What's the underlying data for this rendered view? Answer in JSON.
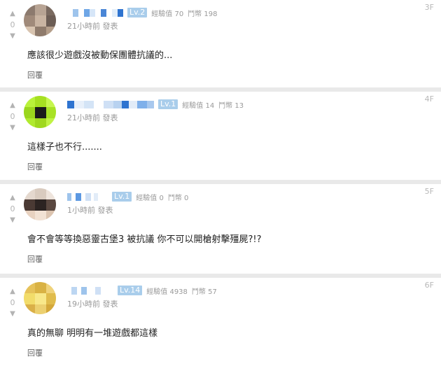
{
  "comments": [
    {
      "floor": "3F",
      "votes": "0",
      "level": "Lv.2",
      "xp": "經驗值 70",
      "coins": "鬥幣 198",
      "time": "21小時前 發表",
      "text": "應該很少遊戲沒被動保團體抗議的...",
      "reply": "回覆",
      "name_blocks": [
        "#ffffff",
        "#9ec4ec",
        "#ffffff",
        "#6ea6e6",
        "#d6e6f8",
        "#ffffff",
        "#4a86d6",
        "#ffffff",
        "#e2eefa",
        "#2f74d0"
      ],
      "avatar_pixels": [
        "#8c7a6e",
        "#b8a494",
        "#7a6a60",
        "#a08a7a",
        "#c9b4a2",
        "#6c5d55",
        "#d8c4b0",
        "#8f7b6c",
        "#b49e8a"
      ]
    },
    {
      "floor": "4F",
      "votes": "0",
      "level": "Lv.1",
      "xp": "經驗值 14",
      "coins": "鬥幣 13",
      "time": "21小時前 發表",
      "text": "這樣子也不行.......",
      "reply": "回覆",
      "name_blocks": [
        "#2f74d0",
        "#e8f0fa",
        "#d4e4f6",
        "#ffffff",
        "#cfe0f5",
        "#b8d2f0",
        "#2f74d0",
        "#e2ecf8",
        "#7fb0ea",
        "#a8c8ee"
      ],
      "avatar_pixels": [
        "#b9f23a",
        "#a6e021",
        "#c6f64e",
        "#9bd61d",
        "#1b1b1b",
        "#a8e225",
        "#b0ea2e",
        "#9fd81e",
        "#c0f244"
      ]
    },
    {
      "floor": "5F",
      "votes": "0",
      "level": "Lv.1",
      "xp": "經驗值 0",
      "coins": "鬥幣 0",
      "time": "1小時前 發表",
      "text": "會不會等等換惡靈古堡3 被抗議 你不可以開槍射擊殭屍?!?",
      "reply": "回覆",
      "name_blocks": [
        "#9ec4ec",
        "#ffffff",
        "#5c98e2",
        "#ffffff",
        "#cfe0f5",
        "#ffffff",
        "#e2ecf8",
        "#ffffff",
        "#ffffff",
        "#ffffff"
      ],
      "avatar_pixels": [
        "#e4d8ce",
        "#d9cbbf",
        "#eee4dc",
        "#4a3a34",
        "#2c2422",
        "#5a4840",
        "#e8d2c0",
        "#f2e2d4",
        "#dcc4b0"
      ]
    },
    {
      "floor": "6F",
      "votes": "0",
      "level": "Lv.14",
      "xp": "經驗值 4938",
      "coins": "鬥幣 57",
      "time": "19小時前 發表",
      "text": "真的無聊 明明有一堆遊戲都這樣",
      "reply": "回覆",
      "name_blocks": [
        "#ffffff",
        "#bcd6f2",
        "#ffffff",
        "#9ec4ec",
        "#ffffff",
        "#ffffff",
        "#cfe0f5",
        "#ffffff",
        "#ffffff",
        "#ffffff"
      ],
      "avatar_pixels": [
        "#e6c25a",
        "#d9b244",
        "#efd27a",
        "#f2dc6a",
        "#f8e88a",
        "#e0bc4c",
        "#dab048",
        "#ecd070",
        "#d4a83a"
      ]
    }
  ]
}
